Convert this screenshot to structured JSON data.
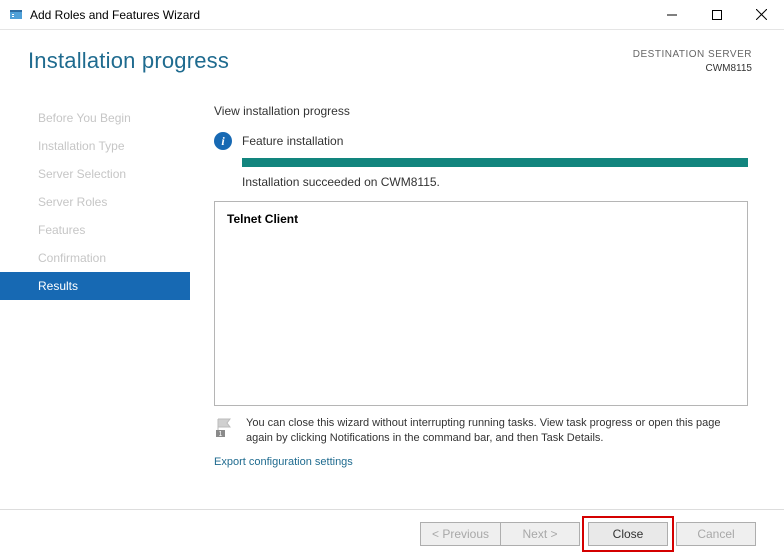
{
  "window": {
    "title": "Add Roles and Features Wizard"
  },
  "header": {
    "page_title": "Installation progress",
    "dest_label": "DESTINATION SERVER",
    "dest_server": "CWM8115"
  },
  "sidenav": {
    "steps": [
      "Before You Begin",
      "Installation Type",
      "Server Selection",
      "Server Roles",
      "Features",
      "Confirmation",
      "Results"
    ],
    "active_index": 6
  },
  "content": {
    "section_head": "View installation progress",
    "status_text": "Feature installation",
    "succeed_text": "Installation succeeded on CWM8115.",
    "features": [
      "Telnet Client"
    ],
    "note_text": "You can close this wizard without interrupting running tasks. View task progress or open this page again by clicking Notifications in the command bar, and then Task Details.",
    "export_link": "Export configuration settings"
  },
  "footer": {
    "previous": "< Previous",
    "next": "Next >",
    "close": "Close",
    "cancel": "Cancel"
  }
}
